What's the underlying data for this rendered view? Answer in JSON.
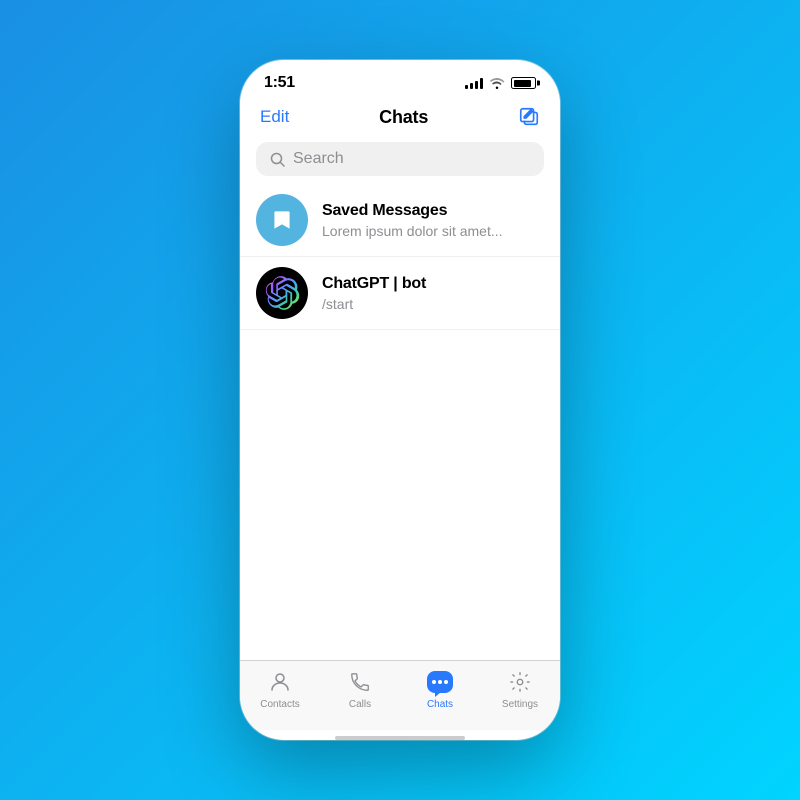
{
  "status_bar": {
    "time": "1:51"
  },
  "nav": {
    "edit_label": "Edit",
    "title": "Chats",
    "compose_label": "Compose"
  },
  "search": {
    "placeholder": "Search"
  },
  "chat_list": [
    {
      "id": "saved-messages",
      "name": "Saved Messages",
      "preview": "Lorem ipsum dolor sit amet...",
      "avatar_type": "saved"
    },
    {
      "id": "chatgpt-bot",
      "name": "ChatGPT | bot",
      "preview": "/start",
      "avatar_type": "chatgpt"
    }
  ],
  "tab_bar": {
    "tabs": [
      {
        "id": "contacts",
        "label": "Contacts",
        "active": false
      },
      {
        "id": "calls",
        "label": "Calls",
        "active": false
      },
      {
        "id": "chats",
        "label": "Chats",
        "active": true
      },
      {
        "id": "settings",
        "label": "Settings",
        "active": false
      }
    ]
  }
}
